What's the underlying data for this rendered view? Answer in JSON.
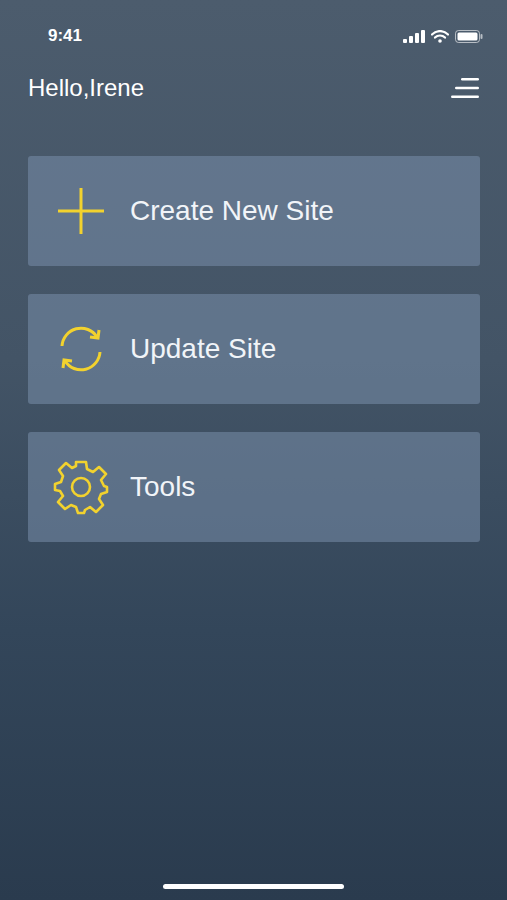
{
  "status_bar": {
    "time": "9:41"
  },
  "header": {
    "greeting": "Hello,Irene"
  },
  "menu": [
    {
      "label": "Create New Site"
    },
    {
      "label": "Update Site"
    },
    {
      "label": "Tools"
    }
  ]
}
